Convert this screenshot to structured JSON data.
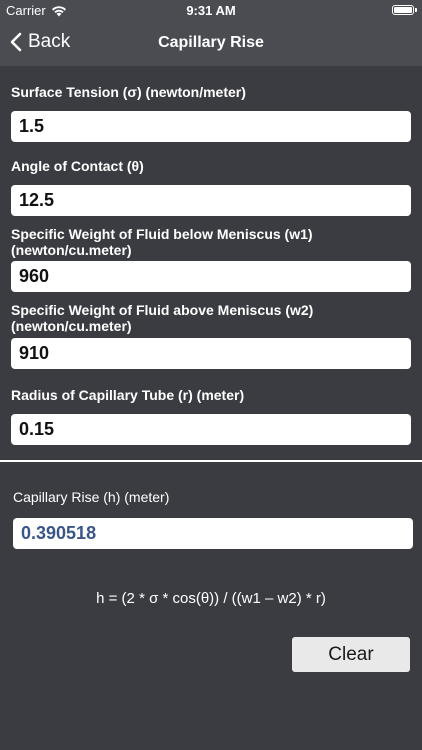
{
  "status_bar": {
    "carrier": "Carrier",
    "time": "9:31 AM"
  },
  "nav": {
    "back_label": "Back",
    "title": "Capillary Rise"
  },
  "fields": [
    {
      "label": "Surface Tension (σ) (newton/meter)",
      "value": "1.5"
    },
    {
      "label": "Angle of Contact (θ)",
      "value": "12.5"
    },
    {
      "label": "Specific Weight of Fluid below Meniscus (w1) (newton/cu.meter)",
      "value": "960"
    },
    {
      "label": "Specific Weight of Fluid above Meniscus (w2) (newton/cu.meter)",
      "value": "910"
    },
    {
      "label": "Radius of Capillary Tube (r) (meter)",
      "value": "0.15"
    }
  ],
  "result": {
    "label": "Capillary Rise (h) (meter)",
    "value": "0.390518"
  },
  "formula": "h = (2 * σ *  cos(θ)) / ((w1 – w2) * r)",
  "buttons": {
    "clear_label": "Clear"
  },
  "colors": {
    "background": "#3a3c41",
    "bar": "#4a4c52",
    "result_text": "#3a5688",
    "button_bg": "#e9e9ea"
  },
  "icons": {
    "wifi": "wifi-icon",
    "battery": "battery-icon",
    "back": "chevron-left-icon"
  }
}
